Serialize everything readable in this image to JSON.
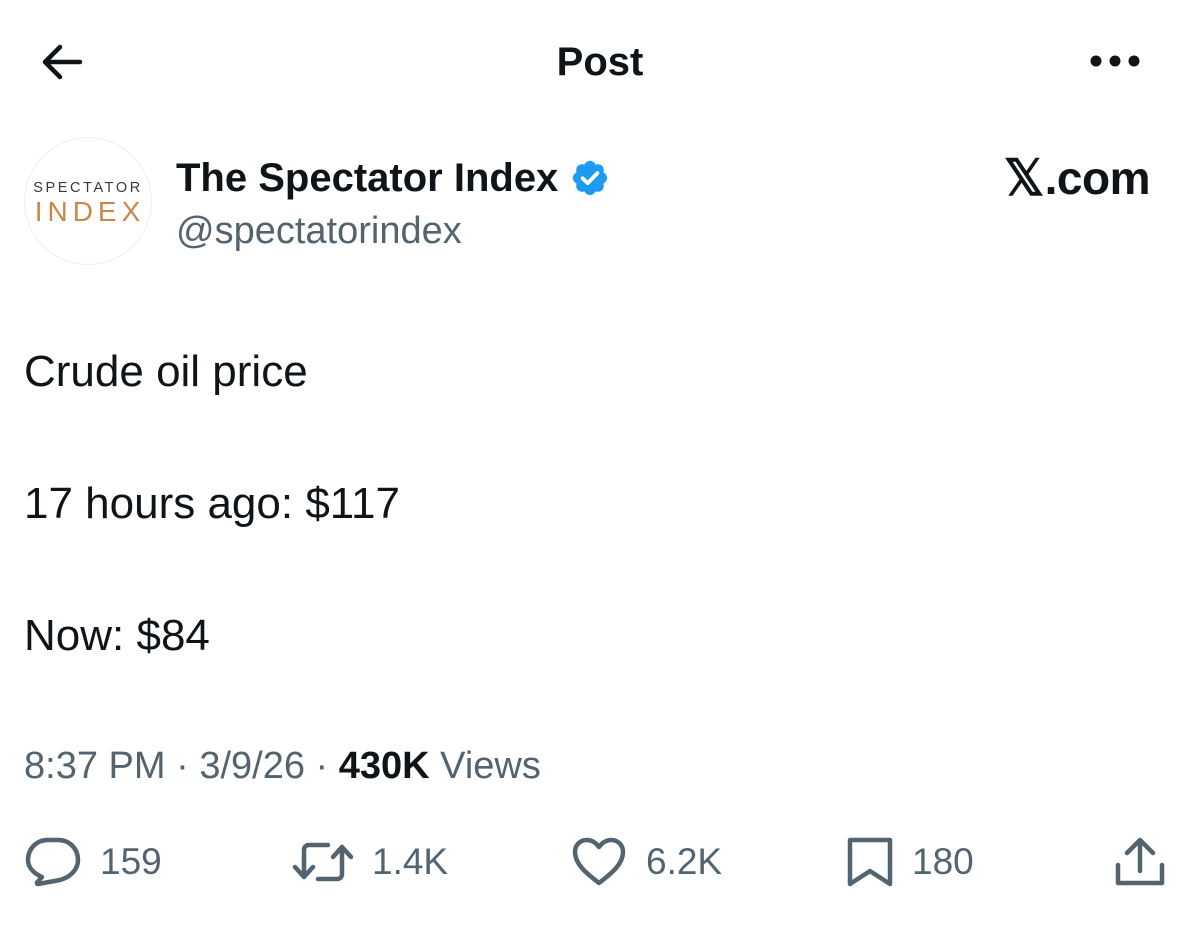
{
  "header": {
    "back_icon": "arrow-left-icon",
    "title": "Post",
    "more_icon": "more-horizontal-icon"
  },
  "author": {
    "avatar_text": {
      "line1": "SPECTATOR",
      "line2": "INDEX"
    },
    "name": "The Spectator Index",
    "verified_icon": "verified-badge-icon",
    "verified_color": "#1d9bf0",
    "handle": "@spectatorindex"
  },
  "watermark": {
    "x_glyph": "𝕏",
    "text": ".com"
  },
  "post": {
    "lines": [
      "Crude oil price",
      "17 hours ago: $117",
      "Now: $84"
    ]
  },
  "meta": {
    "time": "8:37 PM",
    "separator": "·",
    "date": "3/9/26",
    "views_count": "430K",
    "views_label": "Views"
  },
  "actions": {
    "reply": {
      "icon": "reply-icon",
      "count": "159"
    },
    "repost": {
      "icon": "repost-icon",
      "count": "1.4K"
    },
    "like": {
      "icon": "heart-icon",
      "count": "6.2K"
    },
    "bookmark": {
      "icon": "bookmark-icon",
      "count": "180"
    },
    "share": {
      "icon": "share-icon"
    }
  },
  "colors": {
    "text_primary": "#0f1419",
    "text_secondary": "#536471",
    "avatar_accent": "#c8884c"
  }
}
